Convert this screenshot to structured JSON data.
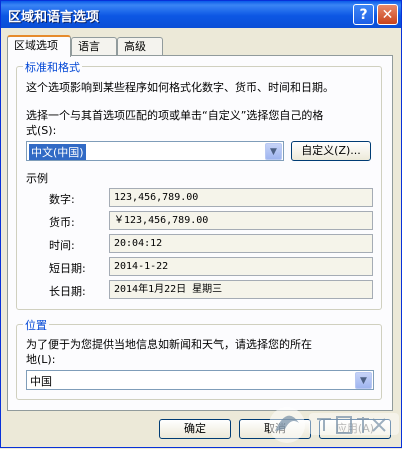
{
  "window": {
    "title": "区域和语言选项",
    "help_label": "?",
    "close_label": "✕"
  },
  "tabs": [
    {
      "label": "区域选项"
    },
    {
      "label": "语言"
    },
    {
      "label": "高级"
    }
  ],
  "standards": {
    "group_label": "标准和格式",
    "description": "这个选项影响到某些程序如何格式化数字、货币、时间和日期。",
    "instruction_line1": "选择一个与其首选项匹配的项或单击“自定义”选择您自己的格",
    "instruction_line2": "式(S):",
    "selected_locale": "中文(中国)",
    "customize_label": "自定义(Z)..."
  },
  "samples": {
    "heading": "示例",
    "rows": [
      {
        "label": "数字:",
        "value": "123,456,789.00"
      },
      {
        "label": "货币:",
        "value": "￥123,456,789.00"
      },
      {
        "label": "时间:",
        "value": "20:04:12"
      },
      {
        "label": "短日期:",
        "value": "2014-1-22"
      },
      {
        "label": "长日期:",
        "value": "2014年1月22日 星期三"
      }
    ]
  },
  "location": {
    "group_label": "位置",
    "description_line1": "为了便于为您提供当地信息如新闻和天气，请选择您的所在",
    "description_line2": "地(L):",
    "selected": "中国"
  },
  "buttons": {
    "ok": "确定",
    "cancel": "取消",
    "apply": "应用(A)"
  },
  "colors": {
    "title_bar": "#0a5be8",
    "group_label": "#0046d5",
    "selection": "#316ac5",
    "tab_accent": "#e68b2c"
  }
}
